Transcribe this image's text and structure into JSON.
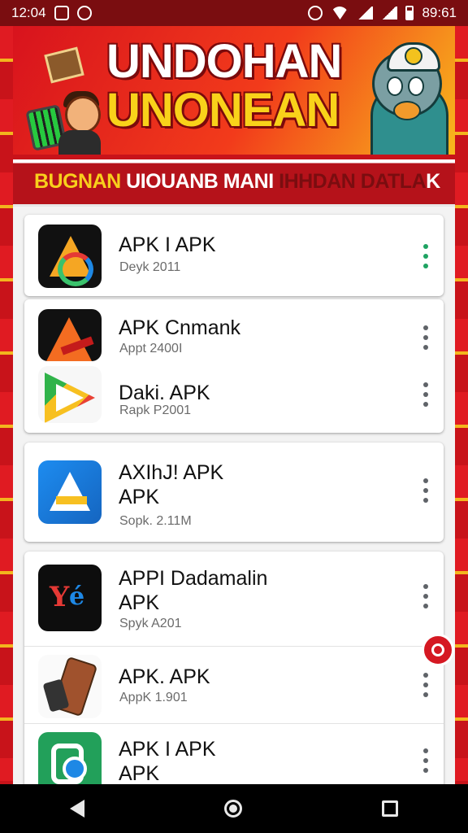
{
  "status_bar": {
    "time_left": "12:04",
    "time_right": "89:61"
  },
  "banner": {
    "title_line1": "UNDOHAN",
    "title_line2": "UNONEAN"
  },
  "subtitle": {
    "part1": "BUGNAN",
    "part2": "UIOUANB MANI",
    "part3": "IHHDAN DATLA",
    "part4": "K"
  },
  "apps": [
    {
      "name": "APK I APK",
      "meta": "Deyk 2011",
      "menu": "green"
    },
    {
      "name": "APK Cnmank",
      "meta": "Appt 2400I"
    },
    {
      "name": "Daki. APK",
      "meta": "Rapk P2001"
    },
    {
      "name": "AXIhJ! APK\nAPK",
      "meta": "Sopk. 2.11M"
    },
    {
      "name": "APPI Dadamalin\nAPK",
      "meta": "Spyk A201"
    },
    {
      "name": "APK. APK",
      "meta": "AppK 1.901"
    },
    {
      "name": "APK I APK\nAPK",
      "meta": ""
    }
  ],
  "icons": {
    "status_left": [
      "message-icon",
      "messenger-icon"
    ],
    "status_right": [
      "alarm-icon",
      "wifi-icon",
      "signal-icon",
      "signal-icon",
      "battery-icon"
    ],
    "more": "more-vertical-icon",
    "nav": [
      "back-icon",
      "home-icon",
      "recent-apps-icon"
    ]
  },
  "colors": {
    "brand_red": "#c8131a",
    "banner_yellow": "#f9d21a",
    "menu_green": "#1ea362"
  }
}
